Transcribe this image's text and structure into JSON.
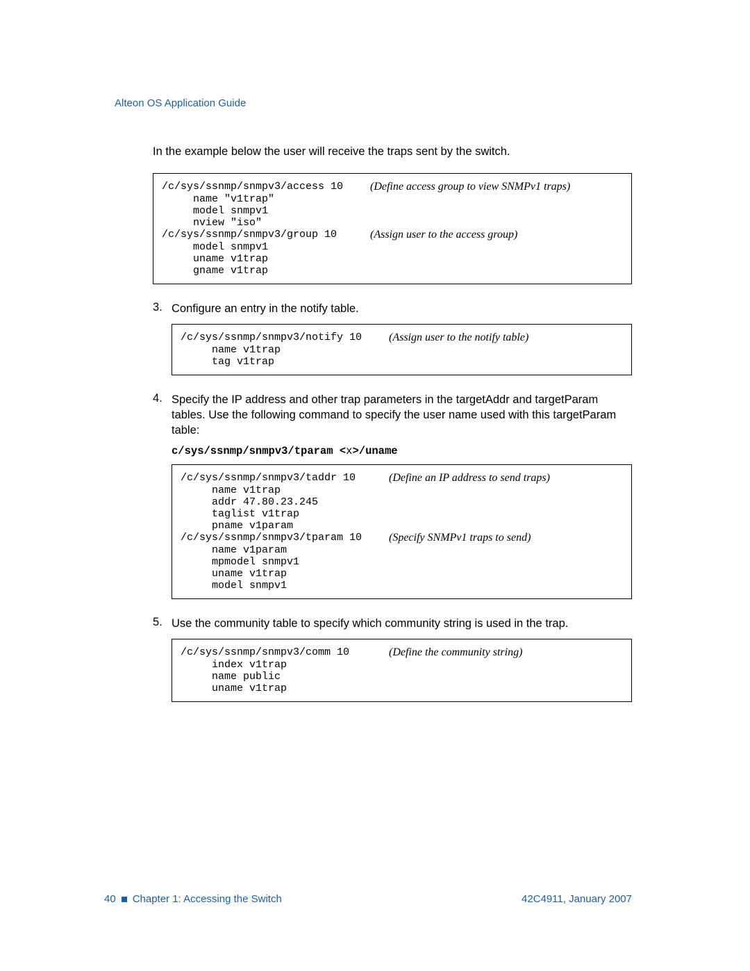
{
  "header": "Alteon OS Application Guide",
  "intro": "In the example below the user will receive the traps sent by the switch.",
  "box1": {
    "l1_cmd": "/c/sys/ssnmp/snmpv3/access 10",
    "l1_note": "(Define access group to view SNMPv1 traps)",
    "l2": "     name \"v1trap\"",
    "l3": "     model snmpv1",
    "l4": "     nview \"iso\"",
    "l5_cmd": "/c/sys/ssnmp/snmpv3/group 10",
    "l5_note": "(Assign user to the access group)",
    "l6": "     model snmpv1",
    "l7": "     uname v1trap",
    "l8": "     gname v1trap"
  },
  "step3": {
    "text": "Configure an entry in the notify table."
  },
  "box2": {
    "l1_cmd": "/c/sys/ssnmp/snmpv3/notify 10",
    "l1_note": "(Assign user to the notify table)",
    "l2": "     name v1trap",
    "l3": "     tag v1trap"
  },
  "step4": {
    "text": "Specify the IP address and other trap parameters in the targetAddr and targetParam tables. Use the following command to specify the user name used with this targetParam table:",
    "bold_pre": "c/sys/ssnmp/snmpv3/tparam <",
    "bold_x": "x",
    "bold_post": ">/uname"
  },
  "box3": {
    "l1_cmd": "/c/sys/ssnmp/snmpv3/taddr 10",
    "l1_note": "(Define an IP address to send traps)",
    "l2": "     name v1trap",
    "l3": "     addr 47.80.23.245",
    "l4": "     taglist v1trap",
    "l5": "     pname v1param",
    "l6_cmd": "/c/sys/ssnmp/snmpv3/tparam 10",
    "l6_note": "(Specify SNMPv1 traps to send)",
    "l7": "     name v1param",
    "l8": "     mpmodel snmpv1",
    "l9": "     uname v1trap",
    "l10": "     model snmpv1"
  },
  "step5": {
    "text": "Use the community table to specify which community string is used in the trap."
  },
  "box4": {
    "l1_cmd": "/c/sys/ssnmp/snmpv3/comm 10",
    "l1_note": "(Define the community string)",
    "l2": "     index v1trap",
    "l3": "     name public",
    "l4": "     uname v1trap"
  },
  "footer": {
    "page": "40",
    "chapter": "Chapter 1:  Accessing the Switch",
    "doc": "42C4911, January 2007"
  }
}
